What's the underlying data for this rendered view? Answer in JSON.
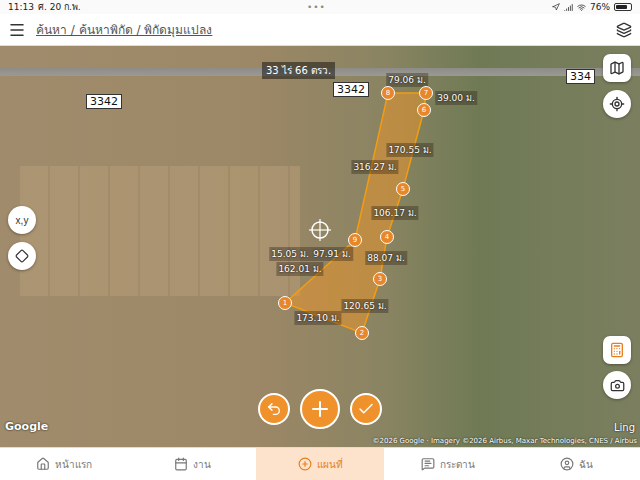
{
  "status_bar": {
    "time": "11:13",
    "date": "ศ. 20 ก.พ.",
    "dots": "•••",
    "battery": "76%",
    "battery_level": 0.76
  },
  "top_bar": {
    "breadcrumb": "ค้นหา / ค้นหาพิกัด / พิกัดมุมแปลง"
  },
  "map": {
    "area_label": "33 ไร่ 66 ตรว.",
    "road_labels": [
      "3342",
      "3342",
      "334"
    ],
    "vertices": [
      {
        "label": "1"
      },
      {
        "label": "2"
      },
      {
        "label": "3"
      },
      {
        "label": "4"
      },
      {
        "label": "5"
      },
      {
        "label": "6"
      },
      {
        "label": "7"
      },
      {
        "label": "8"
      },
      {
        "label": "9"
      }
    ],
    "edge_lengths": [
      "79.06 ม.",
      "39.00 ม.",
      "170.55 ม.",
      "316.27 ม.",
      "106.17 ม.",
      "97.91 ม.",
      "88.07 ม.",
      "15.05 ม.",
      "162.01 ม.",
      "120.65 ม.",
      "173.10 ม."
    ],
    "google": "Google",
    "scale": "Ling",
    "attribution": "©2026 Google · Imagery ©2026 Airbus, Maxar Technologies, CNES / Airbus"
  },
  "left_tools": [
    "x,y"
  ],
  "nav": [
    {
      "label": "หน้าแรก",
      "selected": false
    },
    {
      "label": "งาน",
      "selected": false
    },
    {
      "label": "แผนที่",
      "selected": true
    },
    {
      "label": "กระดาน",
      "selected": false
    },
    {
      "label": "ฉัน",
      "selected": false
    }
  ]
}
